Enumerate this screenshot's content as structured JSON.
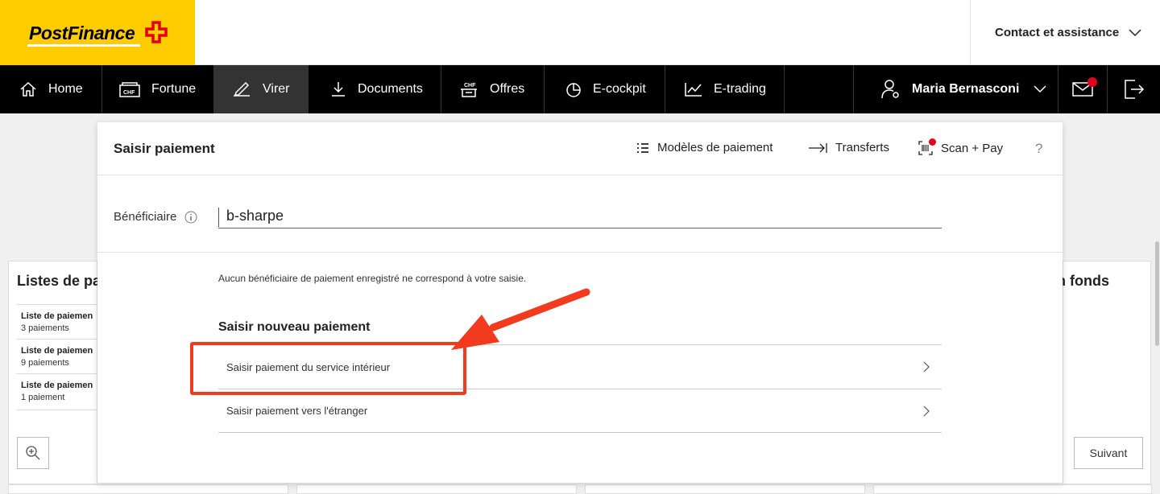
{
  "brand": {
    "name": "PostFinance",
    "color": "#ffcc00",
    "accent_red": "#e3001b"
  },
  "header": {
    "contact_label": "Contact et assistance"
  },
  "nav": {
    "items": [
      {
        "label": "Home",
        "icon": "home-icon"
      },
      {
        "label": "Fortune",
        "icon": "chf-wallet-icon"
      },
      {
        "label": "Virer",
        "icon": "pen-icon",
        "active": true
      },
      {
        "label": "Documents",
        "icon": "download-icon"
      },
      {
        "label": "Offres",
        "icon": "chf-box-icon"
      },
      {
        "label": "E-cockpit",
        "icon": "pie-chart-icon"
      },
      {
        "label": "E-trading",
        "icon": "trend-chart-icon"
      }
    ],
    "user_name": "Maria Bernasconi"
  },
  "background": {
    "left_title": "Listes de pa",
    "right_title": "n fonds",
    "lists": [
      {
        "title": "Liste de paiemen",
        "count": "3 paiements"
      },
      {
        "title": "Liste de paiemen",
        "count": "9 paiements"
      },
      {
        "title": "Liste de paiemen",
        "count": "1 paiement"
      }
    ],
    "next_label": "Suivant"
  },
  "modal": {
    "title": "Saisir paiement",
    "actions": {
      "templates": "Modèles de paiement",
      "transfers": "Transferts",
      "scan_pay": "Scan + Pay",
      "help": "?"
    },
    "beneficiary_label": "Bénéficiaire",
    "beneficiary_value": "b-sharpe",
    "no_match_text": "Aucun bénéficiaire de paiement enregistré ne correspond à votre saisie.",
    "new_payment_title": "Saisir nouveau paiement",
    "options": [
      {
        "label": "Saisir paiement du service intérieur"
      },
      {
        "label": "Saisir paiement vers l'étranger"
      }
    ]
  }
}
